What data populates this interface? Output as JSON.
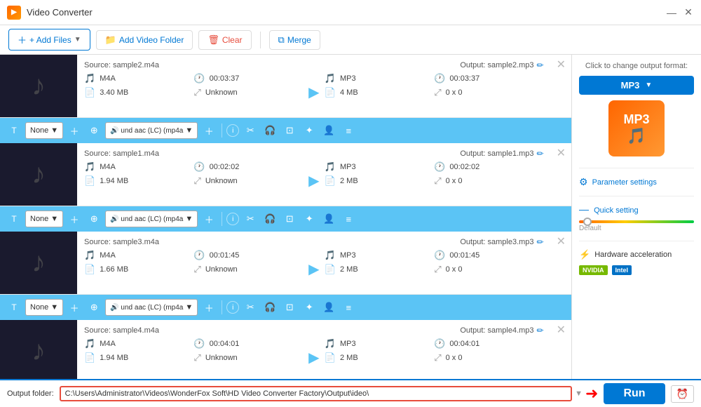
{
  "titleBar": {
    "title": "Video Converter",
    "minimize": "—",
    "close": "✕"
  },
  "toolbar": {
    "addFiles": "+ Add Files",
    "addVideoFolder": "Add Video Folder",
    "clear": "Clear",
    "merge": "Merge"
  },
  "files": [
    {
      "id": 1,
      "source": "Source: sample2.m4a",
      "output": "Output: sample2.mp3",
      "srcFormat": "M4A",
      "srcDuration": "00:03:37",
      "srcSize": "3.40 MB",
      "srcRes": "Unknown",
      "outFormat": "MP3",
      "outDuration": "00:03:37",
      "outSize": "4 MB",
      "outRes": "0 x 0",
      "preset": "None",
      "codec": "und aac (LC) (mp4a"
    },
    {
      "id": 2,
      "source": "Source: sample1.m4a",
      "output": "Output: sample1.mp3",
      "srcFormat": "M4A",
      "srcDuration": "00:02:02",
      "srcSize": "1.94 MB",
      "srcRes": "Unknown",
      "outFormat": "MP3",
      "outDuration": "00:02:02",
      "outSize": "2 MB",
      "outRes": "0 x 0",
      "preset": "None",
      "codec": "und aac (LC) (mp4a"
    },
    {
      "id": 3,
      "source": "Source: sample3.m4a",
      "output": "Output: sample3.mp3",
      "srcFormat": "M4A",
      "srcDuration": "00:01:45",
      "srcSize": "1.66 MB",
      "srcRes": "Unknown",
      "outFormat": "MP3",
      "outDuration": "00:01:45",
      "outSize": "2 MB",
      "outRes": "0 x 0",
      "preset": "None",
      "codec": "und aac (LC) (mp4a"
    },
    {
      "id": 4,
      "source": "Source: sample4.m4a",
      "output": "Output: sample4.mp3",
      "srcFormat": "M4A",
      "srcDuration": "00:04:01",
      "srcSize": "1.94 MB",
      "srcRes": "Unknown",
      "outFormat": "MP3",
      "outDuration": "00:04:01",
      "outSize": "2 MB",
      "outRes": "0 x 0",
      "preset": "None",
      "codec": "und aac (LC) (mp4a"
    }
  ],
  "rightPanel": {
    "hint": "Click to change output format:",
    "format": "MP3",
    "paramSettings": "Parameter settings",
    "quickSetting": "Quick setting",
    "sliderLabel": "Default",
    "hwAccel": "Hardware acceleration",
    "nvidia": "NVIDIA",
    "intel": "Intel"
  },
  "bottomBar": {
    "outputFolderLabel": "Output folder:",
    "outputPath": "C:\\Users\\Administrator\\Videos\\WonderFox Soft\\HD Video Converter Factory\\Output\\ideo\\",
    "runLabel": "Run"
  }
}
